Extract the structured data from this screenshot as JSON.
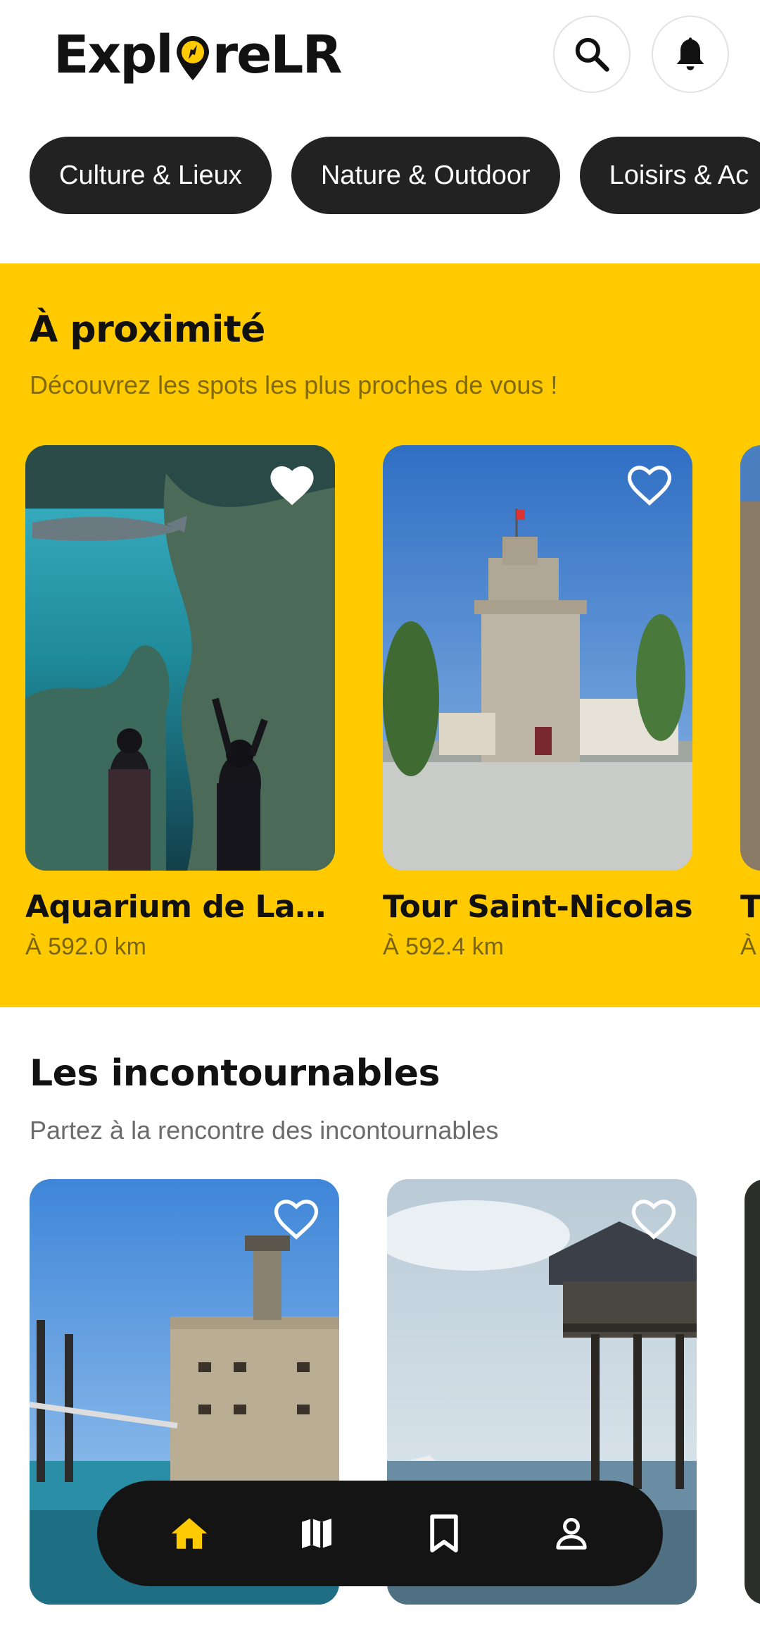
{
  "app": {
    "logo_prefix": "Expl",
    "logo_suffix": "reLR",
    "logo_icon": "compass-pin-icon",
    "accent_color": "#FFCA00",
    "dark_color": "#141414"
  },
  "header": {
    "search_icon": "search-icon",
    "bell_icon": "bell-icon"
  },
  "categories": [
    {
      "label": "Culture & Lieux"
    },
    {
      "label": "Nature & Outdoor"
    },
    {
      "label": "Loisirs & Ac"
    }
  ],
  "nearby": {
    "title": "À proximité",
    "subtitle": "Découvrez les spots les plus proches de vous !",
    "cards": [
      {
        "name": "Aquarium de La Roc…",
        "distance": "À 592.0 km",
        "favorite": true,
        "image": "aquarium"
      },
      {
        "name": "Tour Saint-Nicolas",
        "distance": "À 592.4 km",
        "favorite": false,
        "image": "tower"
      },
      {
        "name": "T",
        "distance": "À",
        "favorite": false,
        "image": "stone"
      }
    ]
  },
  "mustsee": {
    "title": "Les incontournables",
    "subtitle": "Partez à la rencontre des incontournables",
    "cards": [
      {
        "image": "fort-boyard",
        "favorite": false
      },
      {
        "image": "fishing-hut",
        "favorite": false
      }
    ]
  },
  "bottom_nav": {
    "items": [
      {
        "icon": "home-icon",
        "active": true
      },
      {
        "icon": "map-icon",
        "active": false
      },
      {
        "icon": "bookmark-icon",
        "active": false
      },
      {
        "icon": "profile-icon",
        "active": false
      }
    ]
  }
}
